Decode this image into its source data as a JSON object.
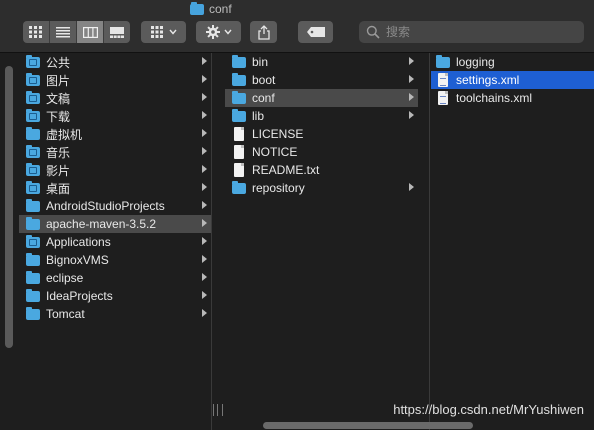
{
  "window": {
    "title": "conf"
  },
  "toolbar": {
    "search_placeholder": "搜索"
  },
  "colors": {
    "folder": "#4aa8e0",
    "selection_active": "#1e5fd3",
    "selection_inactive": "#4a4a4a",
    "background": "#1e1e1e"
  },
  "sidebar_icons": [
    "folder-icon"
  ],
  "column1": {
    "items": [
      {
        "label": "公共",
        "icon": "public-folder-icon"
      },
      {
        "label": "图片",
        "icon": "pictures-folder-icon"
      },
      {
        "label": "文稿",
        "icon": "documents-folder-icon"
      },
      {
        "label": "下载",
        "icon": "downloads-folder-icon"
      },
      {
        "label": "虚拟机",
        "icon": "folder-icon"
      },
      {
        "label": "音乐",
        "icon": "music-folder-icon"
      },
      {
        "label": "影片",
        "icon": "movies-folder-icon"
      },
      {
        "label": "桌面",
        "icon": "desktop-folder-icon"
      },
      {
        "label": "AndroidStudioProjects",
        "icon": "folder-icon"
      },
      {
        "label": "apache-maven-3.5.2",
        "icon": "folder-icon"
      },
      {
        "label": "Applications",
        "icon": "applications-folder-icon"
      },
      {
        "label": "BignoxVMS",
        "icon": "folder-icon"
      },
      {
        "label": "eclipse",
        "icon": "folder-icon"
      },
      {
        "label": "IdeaProjects",
        "icon": "folder-icon"
      },
      {
        "label": "Tomcat",
        "icon": "folder-icon"
      }
    ]
  },
  "column2": {
    "items": [
      {
        "label": "bin",
        "type": "folder"
      },
      {
        "label": "boot",
        "type": "folder"
      },
      {
        "label": "conf",
        "type": "folder"
      },
      {
        "label": "lib",
        "type": "folder"
      },
      {
        "label": "LICENSE",
        "type": "file"
      },
      {
        "label": "NOTICE",
        "type": "file"
      },
      {
        "label": "README.txt",
        "type": "file"
      },
      {
        "label": "repository",
        "type": "folder"
      }
    ]
  },
  "column3": {
    "items": [
      {
        "label": "logging",
        "type": "folder"
      },
      {
        "label": "settings.xml",
        "type": "xml-file"
      },
      {
        "label": "toolchains.xml",
        "type": "xml-file"
      }
    ]
  },
  "watermark": "https://blog.csdn.net/MrYushiwen"
}
